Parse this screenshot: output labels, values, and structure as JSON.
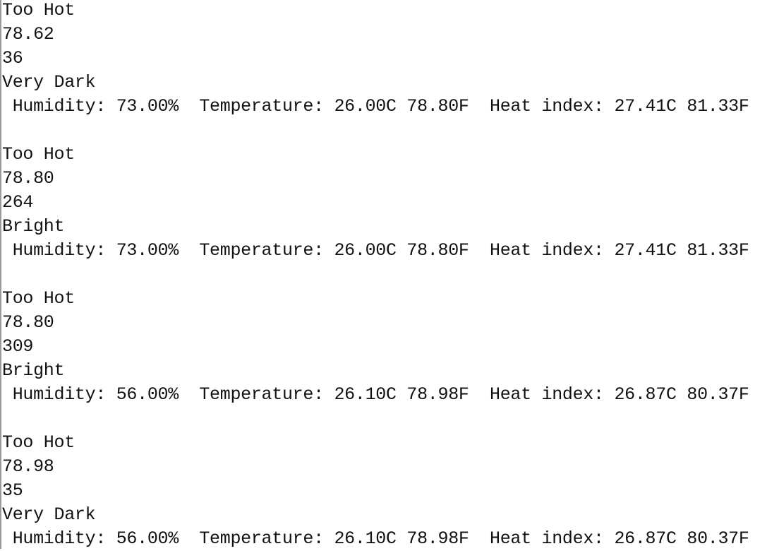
{
  "serial_monitor": {
    "lines": [
      "Too Hot",
      "78.62",
      "36",
      "Very Dark",
      " Humidity: 73.00%  Temperature: 26.00C 78.80F  Heat index: 27.41C 81.33F",
      "",
      "Too Hot",
      "78.80",
      "264",
      "Bright",
      " Humidity: 73.00%  Temperature: 26.00C 78.80F  Heat index: 27.41C 81.33F",
      "",
      "Too Hot",
      "78.80",
      "309",
      "Bright",
      " Humidity: 56.00%  Temperature: 26.10C 78.98F  Heat index: 26.87C 80.37F",
      "",
      "Too Hot",
      "78.98",
      "35",
      "Very Dark",
      " Humidity: 56.00%  Temperature: 26.10C 78.98F  Heat index: 26.87C 80.37F"
    ]
  }
}
